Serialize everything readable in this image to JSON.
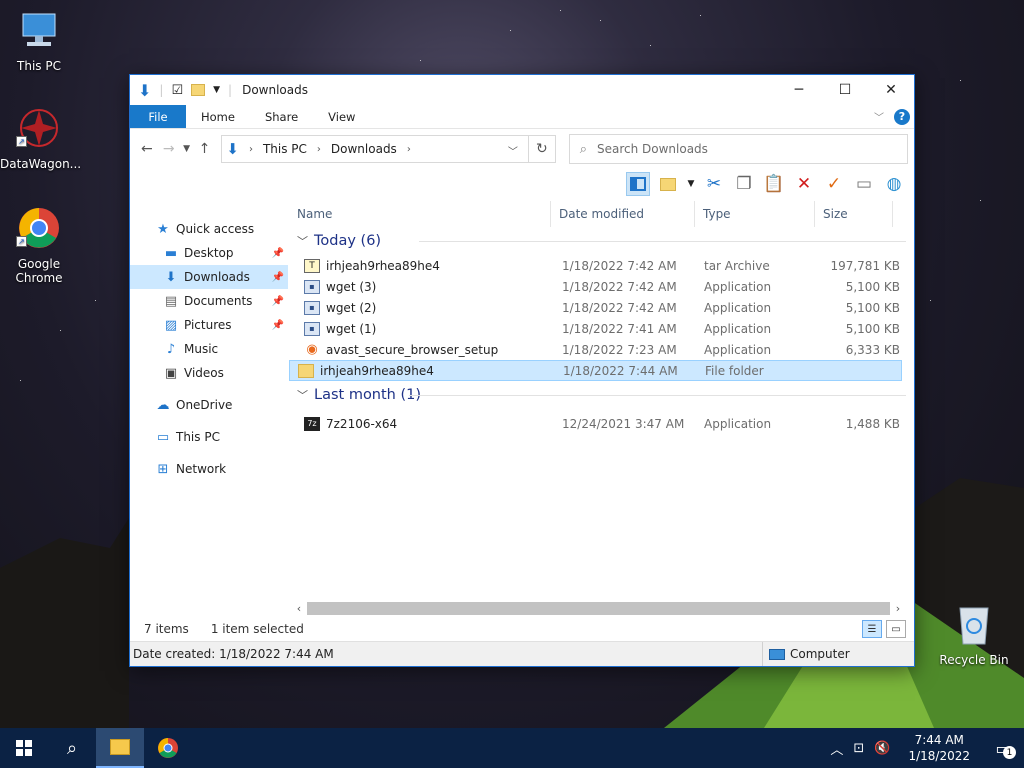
{
  "desktop": {
    "icons": [
      {
        "label": "This PC",
        "icon": "monitor-icon"
      },
      {
        "label": "DataWagon...",
        "icon": "datawagon-icon"
      },
      {
        "label": "Google Chrome",
        "icon": "chrome-icon"
      },
      {
        "label": "Recycle Bin",
        "icon": "recycle-bin-icon"
      }
    ]
  },
  "window": {
    "title": "Downloads",
    "ribbon_tabs": [
      "File",
      "Home",
      "Share",
      "View"
    ],
    "breadcrumb": [
      "This PC",
      "Downloads"
    ],
    "search_placeholder": "Search Downloads",
    "nav": [
      {
        "label": "Quick access",
        "icon": "star-icon"
      },
      {
        "label": "Desktop",
        "icon": "desktop-folder-icon",
        "pinned": true
      },
      {
        "label": "Downloads",
        "icon": "download-arrow-icon",
        "pinned": true,
        "selected": true
      },
      {
        "label": "Documents",
        "icon": "documents-icon",
        "pinned": true
      },
      {
        "label": "Pictures",
        "icon": "pictures-icon",
        "pinned": true
      },
      {
        "label": "Music",
        "icon": "music-icon"
      },
      {
        "label": "Videos",
        "icon": "videos-icon"
      },
      {
        "label": "OneDrive",
        "icon": "cloud-icon"
      },
      {
        "label": "This PC",
        "icon": "monitor-icon"
      },
      {
        "label": "Network",
        "icon": "network-icon"
      }
    ],
    "columns": [
      "Name",
      "Date modified",
      "Type",
      "Size"
    ],
    "groups": [
      {
        "label": "Today (6)",
        "files": [
          {
            "name": "irhjeah9rhea89he4",
            "date": "1/18/2022 7:42 AM",
            "type": "tar Archive",
            "size": "197,781 KB",
            "icon": "tar"
          },
          {
            "name": "wget (3)",
            "date": "1/18/2022 7:42 AM",
            "type": "Application",
            "size": "5,100 KB",
            "icon": "app"
          },
          {
            "name": "wget (2)",
            "date": "1/18/2022 7:42 AM",
            "type": "Application",
            "size": "5,100 KB",
            "icon": "app"
          },
          {
            "name": "wget (1)",
            "date": "1/18/2022 7:41 AM",
            "type": "Application",
            "size": "5,100 KB",
            "icon": "app"
          },
          {
            "name": "avast_secure_browser_setup",
            "date": "1/18/2022 7:23 AM",
            "type": "Application",
            "size": "6,333 KB",
            "icon": "avast"
          },
          {
            "name": "irhjeah9rhea89he4",
            "date": "1/18/2022 7:44 AM",
            "type": "File folder",
            "size": "",
            "icon": "folder",
            "selected": true
          }
        ]
      },
      {
        "label": "Last month (1)",
        "files": [
          {
            "name": "7z2106-x64",
            "date": "12/24/2021 3:47 AM",
            "type": "Application",
            "size": "1,488 KB",
            "icon": "z7"
          }
        ]
      }
    ],
    "status": {
      "items": "7 items",
      "selected": "1 item selected"
    },
    "details": {
      "text": "Date created: 1/18/2022 7:44 AM",
      "location": "Computer"
    }
  },
  "taskbar": {
    "time": "7:44 AM",
    "date": "1/18/2022",
    "notifications": "1"
  }
}
